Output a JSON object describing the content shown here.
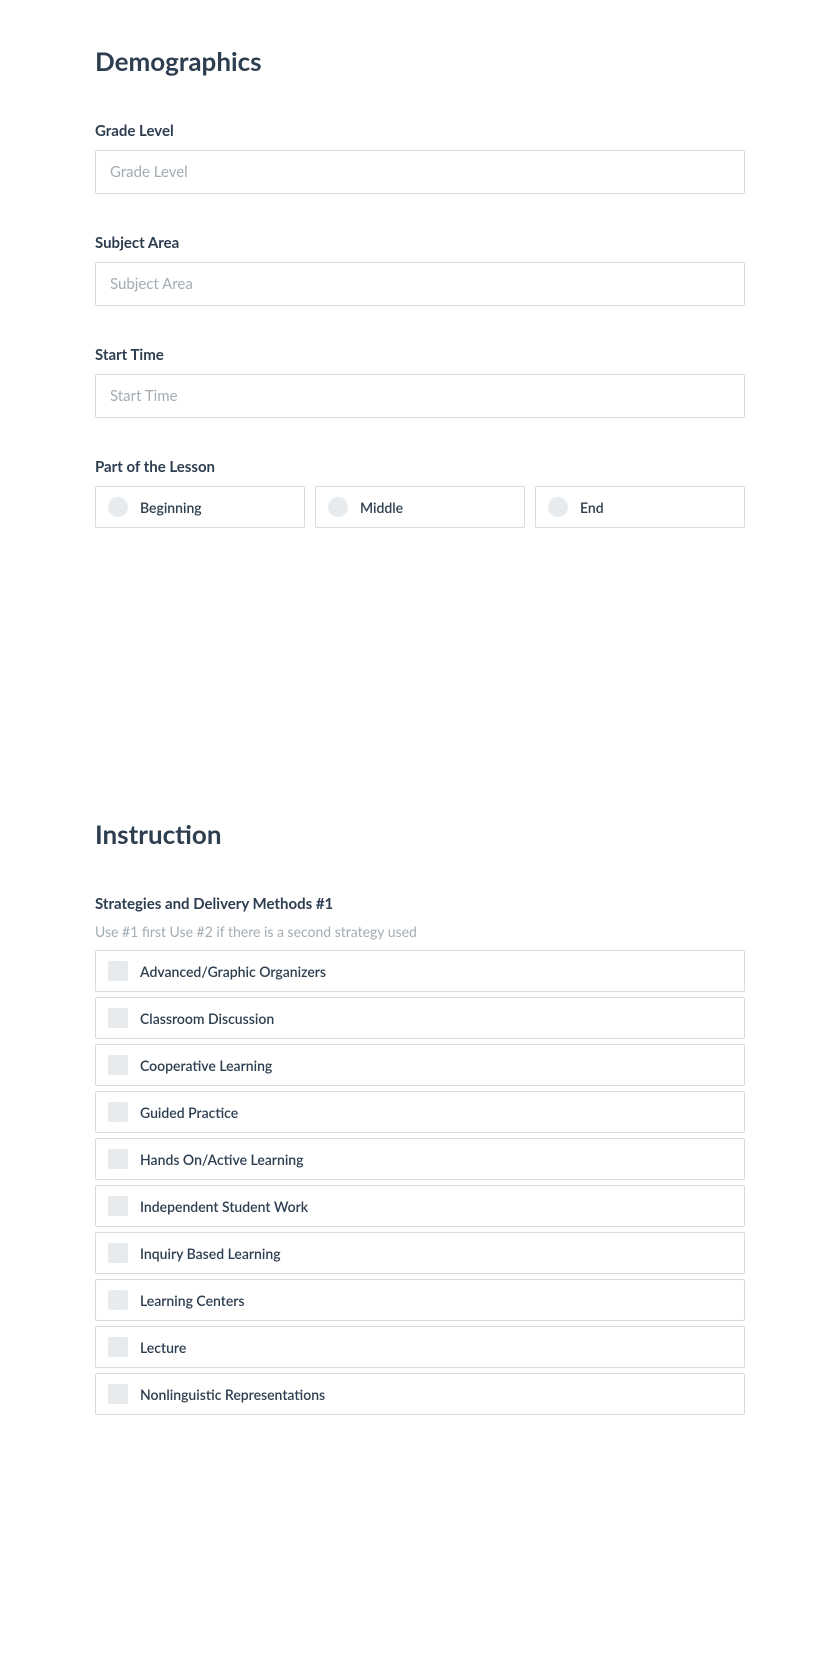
{
  "demographics": {
    "title": "Demographics",
    "gradeLevel": {
      "label": "Grade Level",
      "placeholder": "Grade Level"
    },
    "subjectArea": {
      "label": "Subject Area",
      "placeholder": "Subject Area"
    },
    "startTime": {
      "label": "Start Time",
      "placeholder": "Start Time"
    },
    "partOfLesson": {
      "label": "Part of the Lesson",
      "options": [
        "Beginning",
        "Middle",
        "End"
      ]
    }
  },
  "instruction": {
    "title": "Instruction",
    "strategies": {
      "label": "Strategies and Delivery Methods #1",
      "hint": "Use #1 first Use #2 if there is a second strategy used",
      "options": [
        "Advanced/Graphic Organizers",
        "Classroom Discussion",
        "Cooperative Learning",
        "Guided Practice",
        "Hands On/Active Learning",
        "Independent Student Work",
        "Inquiry Based Learning",
        "Learning Centers",
        "Lecture",
        "Nonlinguistic Representations"
      ]
    }
  }
}
